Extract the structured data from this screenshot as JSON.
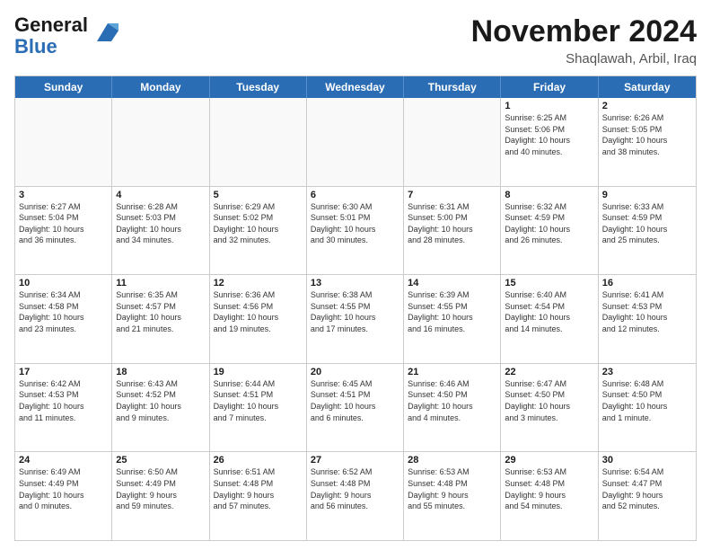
{
  "header": {
    "logo_general": "General",
    "logo_blue": "Blue",
    "month_title": "November 2024",
    "location": "Shaqlawah, Arbil, Iraq"
  },
  "days_of_week": [
    "Sunday",
    "Monday",
    "Tuesday",
    "Wednesday",
    "Thursday",
    "Friday",
    "Saturday"
  ],
  "weeks": [
    [
      {
        "day": "",
        "info": "",
        "empty": true
      },
      {
        "day": "",
        "info": "",
        "empty": true
      },
      {
        "day": "",
        "info": "",
        "empty": true
      },
      {
        "day": "",
        "info": "",
        "empty": true
      },
      {
        "day": "",
        "info": "",
        "empty": true
      },
      {
        "day": "1",
        "info": "Sunrise: 6:25 AM\nSunset: 5:06 PM\nDaylight: 10 hours\nand 40 minutes."
      },
      {
        "day": "2",
        "info": "Sunrise: 6:26 AM\nSunset: 5:05 PM\nDaylight: 10 hours\nand 38 minutes."
      }
    ],
    [
      {
        "day": "3",
        "info": "Sunrise: 6:27 AM\nSunset: 5:04 PM\nDaylight: 10 hours\nand 36 minutes."
      },
      {
        "day": "4",
        "info": "Sunrise: 6:28 AM\nSunset: 5:03 PM\nDaylight: 10 hours\nand 34 minutes."
      },
      {
        "day": "5",
        "info": "Sunrise: 6:29 AM\nSunset: 5:02 PM\nDaylight: 10 hours\nand 32 minutes."
      },
      {
        "day": "6",
        "info": "Sunrise: 6:30 AM\nSunset: 5:01 PM\nDaylight: 10 hours\nand 30 minutes."
      },
      {
        "day": "7",
        "info": "Sunrise: 6:31 AM\nSunset: 5:00 PM\nDaylight: 10 hours\nand 28 minutes."
      },
      {
        "day": "8",
        "info": "Sunrise: 6:32 AM\nSunset: 4:59 PM\nDaylight: 10 hours\nand 26 minutes."
      },
      {
        "day": "9",
        "info": "Sunrise: 6:33 AM\nSunset: 4:59 PM\nDaylight: 10 hours\nand 25 minutes."
      }
    ],
    [
      {
        "day": "10",
        "info": "Sunrise: 6:34 AM\nSunset: 4:58 PM\nDaylight: 10 hours\nand 23 minutes."
      },
      {
        "day": "11",
        "info": "Sunrise: 6:35 AM\nSunset: 4:57 PM\nDaylight: 10 hours\nand 21 minutes."
      },
      {
        "day": "12",
        "info": "Sunrise: 6:36 AM\nSunset: 4:56 PM\nDaylight: 10 hours\nand 19 minutes."
      },
      {
        "day": "13",
        "info": "Sunrise: 6:38 AM\nSunset: 4:55 PM\nDaylight: 10 hours\nand 17 minutes."
      },
      {
        "day": "14",
        "info": "Sunrise: 6:39 AM\nSunset: 4:55 PM\nDaylight: 10 hours\nand 16 minutes."
      },
      {
        "day": "15",
        "info": "Sunrise: 6:40 AM\nSunset: 4:54 PM\nDaylight: 10 hours\nand 14 minutes."
      },
      {
        "day": "16",
        "info": "Sunrise: 6:41 AM\nSunset: 4:53 PM\nDaylight: 10 hours\nand 12 minutes."
      }
    ],
    [
      {
        "day": "17",
        "info": "Sunrise: 6:42 AM\nSunset: 4:53 PM\nDaylight: 10 hours\nand 11 minutes."
      },
      {
        "day": "18",
        "info": "Sunrise: 6:43 AM\nSunset: 4:52 PM\nDaylight: 10 hours\nand 9 minutes."
      },
      {
        "day": "19",
        "info": "Sunrise: 6:44 AM\nSunset: 4:51 PM\nDaylight: 10 hours\nand 7 minutes."
      },
      {
        "day": "20",
        "info": "Sunrise: 6:45 AM\nSunset: 4:51 PM\nDaylight: 10 hours\nand 6 minutes."
      },
      {
        "day": "21",
        "info": "Sunrise: 6:46 AM\nSunset: 4:50 PM\nDaylight: 10 hours\nand 4 minutes."
      },
      {
        "day": "22",
        "info": "Sunrise: 6:47 AM\nSunset: 4:50 PM\nDaylight: 10 hours\nand 3 minutes."
      },
      {
        "day": "23",
        "info": "Sunrise: 6:48 AM\nSunset: 4:50 PM\nDaylight: 10 hours\nand 1 minute."
      }
    ],
    [
      {
        "day": "24",
        "info": "Sunrise: 6:49 AM\nSunset: 4:49 PM\nDaylight: 10 hours\nand 0 minutes."
      },
      {
        "day": "25",
        "info": "Sunrise: 6:50 AM\nSunset: 4:49 PM\nDaylight: 9 hours\nand 59 minutes."
      },
      {
        "day": "26",
        "info": "Sunrise: 6:51 AM\nSunset: 4:48 PM\nDaylight: 9 hours\nand 57 minutes."
      },
      {
        "day": "27",
        "info": "Sunrise: 6:52 AM\nSunset: 4:48 PM\nDaylight: 9 hours\nand 56 minutes."
      },
      {
        "day": "28",
        "info": "Sunrise: 6:53 AM\nSunset: 4:48 PM\nDaylight: 9 hours\nand 55 minutes."
      },
      {
        "day": "29",
        "info": "Sunrise: 6:53 AM\nSunset: 4:48 PM\nDaylight: 9 hours\nand 54 minutes."
      },
      {
        "day": "30",
        "info": "Sunrise: 6:54 AM\nSunset: 4:47 PM\nDaylight: 9 hours\nand 52 minutes."
      }
    ]
  ]
}
